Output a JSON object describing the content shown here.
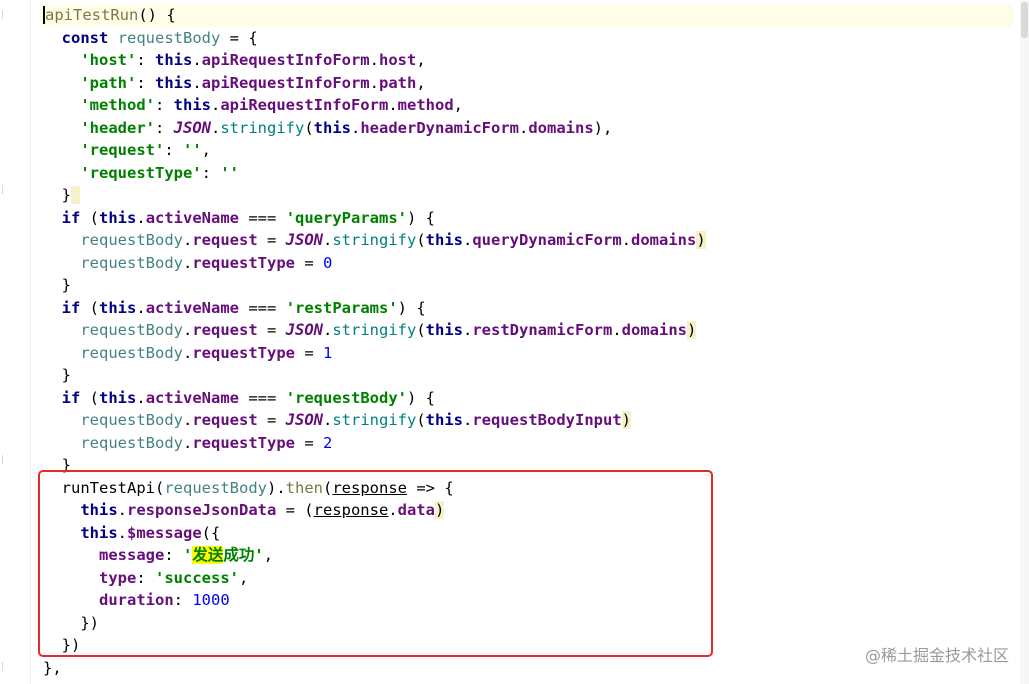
{
  "colors": {
    "keyword": "#000080",
    "string": "#008000",
    "number": "#0000ff",
    "highlight_box": "#e22a2a",
    "current_line": "#fffde8"
  },
  "code": {
    "l1_fn": "apiTestRun",
    "l1_rest": "() {",
    "l2_const": "const",
    "l2_var": "requestBody",
    "l2_rest": " = {",
    "l3_key": "'host'",
    "l3_sep": ": ",
    "l3_this": "this",
    "l3_a": ".",
    "l3_form": "apiRequestInfoForm",
    "l3_b": ".",
    "l3_prop": "host",
    "l3_end": ",",
    "l4_key": "'path'",
    "l4_sep": ": ",
    "l4_this": "this",
    "l4_a": ".",
    "l4_form": "apiRequestInfoForm",
    "l4_b": ".",
    "l4_prop": "path",
    "l4_end": ",",
    "l5_key": "'method'",
    "l5_sep": ": ",
    "l5_this": "this",
    "l5_a": ".",
    "l5_form": "apiRequestInfoForm",
    "l5_b": ".",
    "l5_prop": "method",
    "l5_end": ",",
    "l6_key": "'header'",
    "l6_sep": ": ",
    "l6_json": "JSON",
    "l6_a": ".",
    "l6_fn": "stringify",
    "l6_b": "(",
    "l6_this": "this",
    "l6_c": ".",
    "l6_form": "headerDynamicForm",
    "l6_d": ".",
    "l6_prop": "domains",
    "l6_end": "),",
    "l7_key": "'request'",
    "l7_sep": ": ",
    "l7_val": "''",
    "l7_end": ",",
    "l8_key": "'requestType'",
    "l8_sep": ": ",
    "l8_val": "''",
    "l9_brace": "}",
    "l10_if": "if",
    "l10_a": " (",
    "l10_this": "this",
    "l10_b": ".",
    "l10_prop": "activeName",
    "l10_op": " === ",
    "l10_str": "'queryParams'",
    "l10_end": ") {",
    "l11_var": "requestBody",
    "l11_a": ".",
    "l11_prop": "request",
    "l11_op": " = ",
    "l11_json": "JSON",
    "l11_b": ".",
    "l11_fn": "stringify",
    "l11_c": "(",
    "l11_this": "this",
    "l11_d": ".",
    "l11_form": "queryDynamicForm",
    "l11_e": ".",
    "l11_prop2": "domains",
    "l11_end": ")",
    "l12_var": "requestBody",
    "l12_a": ".",
    "l12_prop": "requestType",
    "l12_op": " = ",
    "l12_num": "0",
    "l13_brace": "}",
    "l14_if": "if",
    "l14_a": " (",
    "l14_this": "this",
    "l14_b": ".",
    "l14_prop": "activeName",
    "l14_op": " === ",
    "l14_str": "'restParams'",
    "l14_end": ") {",
    "l15_var": "requestBody",
    "l15_a": ".",
    "l15_prop": "request",
    "l15_op": " = ",
    "l15_json": "JSON",
    "l15_b": ".",
    "l15_fn": "stringify",
    "l15_c": "(",
    "l15_this": "this",
    "l15_d": ".",
    "l15_form": "restDynamicForm",
    "l15_e": ".",
    "l15_prop2": "domains",
    "l15_end": ")",
    "l16_var": "requestBody",
    "l16_a": ".",
    "l16_prop": "requestType",
    "l16_op": " = ",
    "l16_num": "1",
    "l17_brace": "}",
    "l18_if": "if",
    "l18_a": " (",
    "l18_this": "this",
    "l18_b": ".",
    "l18_prop": "activeName",
    "l18_op": " === ",
    "l18_str": "'requestBody'",
    "l18_end": ") {",
    "l19_var": "requestBody",
    "l19_a": ".",
    "l19_prop": "request",
    "l19_op": " = ",
    "l19_json": "JSON",
    "l19_b": ".",
    "l19_fn": "stringify",
    "l19_c": "(",
    "l19_this": "this",
    "l19_d": ".",
    "l19_input": "requestBodyInput",
    "l19_end": ")",
    "l20_var": "requestBody",
    "l20_a": ".",
    "l20_prop": "requestType",
    "l20_op": " = ",
    "l20_num": "2",
    "l21_brace": "}",
    "l22_fn": "runTestApi",
    "l22_a": "(",
    "l22_arg": "requestBody",
    "l22_b": ").",
    "l22_then": "then",
    "l22_c": "(",
    "l22_param": "response",
    "l22_end": " => {",
    "l23_this": "this",
    "l23_a": ".",
    "l23_prop": "responseJsonData",
    "l23_op": " = (",
    "l23_param": "response",
    "l23_b": ".",
    "l23_data": "data",
    "l23_end": ")",
    "l24_this": "this",
    "l24_a": ".",
    "l24_msg": "$message",
    "l24_end": "({",
    "l25_key": "message",
    "l25_sep": ": ",
    "l25_q1": "'",
    "l25_hl": "发送",
    "l25_rest": "成功'",
    "l25_end": ",",
    "l26_key": "type",
    "l26_sep": ": ",
    "l26_str": "'success'",
    "l26_end": ",",
    "l27_key": "duration",
    "l27_sep": ": ",
    "l27_num": "1000",
    "l28_close": "})",
    "l29_close": "})",
    "l30_close": "},"
  },
  "watermark": "@稀土掘金技术社区"
}
